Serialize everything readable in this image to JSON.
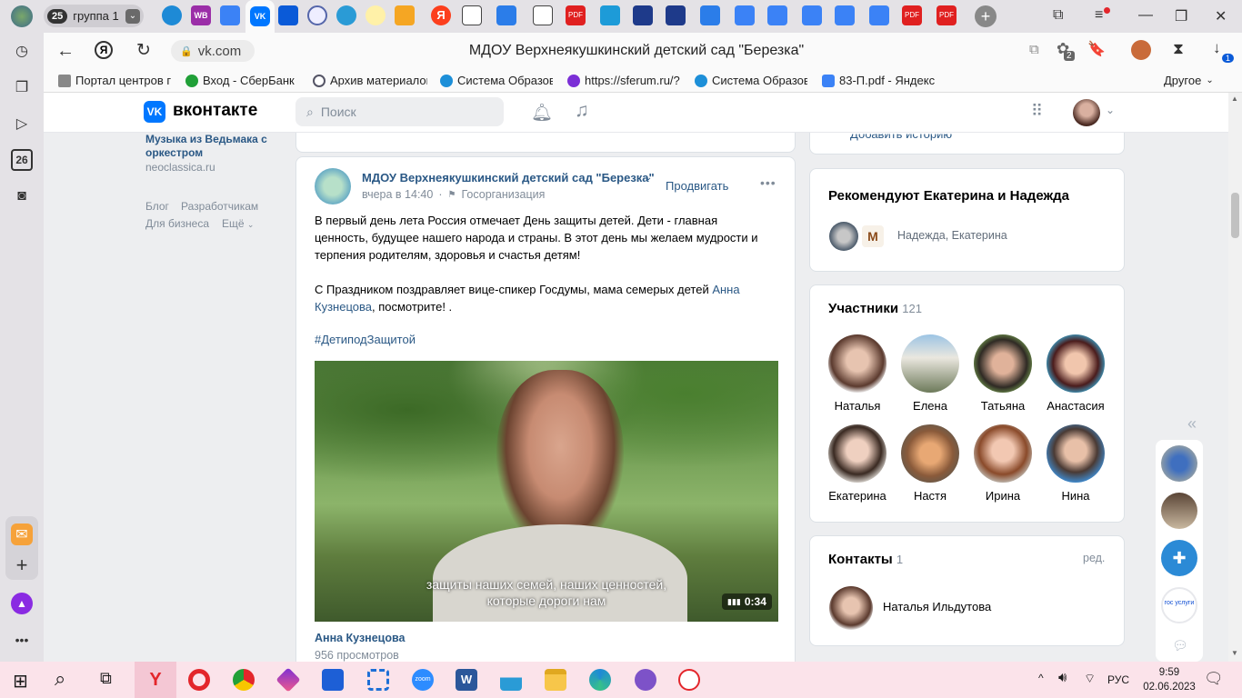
{
  "tabstrip": {
    "group_count": "25",
    "group_name": "группа 1"
  },
  "navbar": {
    "url": "vk.com",
    "page_title": "МДОУ Верхнеякушкинский детский сад \"Березка\"",
    "downloads_badge": "1",
    "extensions_badge": "2"
  },
  "bookmarks": {
    "items": [
      {
        "label": "Портал центров г"
      },
      {
        "label": "Вход - СберБанк С"
      },
      {
        "label": "Архив материалов"
      },
      {
        "label": "Система Образов"
      },
      {
        "label": "https://sferum.ru/?"
      },
      {
        "label": "Система Образов"
      },
      {
        "label": "83-П.pdf - Яндекс"
      }
    ],
    "other": "Другое"
  },
  "left_sidebar": {
    "calendar_day": "26"
  },
  "vk_header": {
    "logo": "VK",
    "name": "вконтакте",
    "search_placeholder": "Поиск"
  },
  "left_column": {
    "playlist_title": "Музыка из Ведьмака с оркестром",
    "playlist_source": "neoclassica.ru",
    "footer_links": [
      "Блог",
      "Разработчикам",
      "Для бизнеса",
      "Ещё"
    ]
  },
  "post": {
    "author": "МДОУ Верхнеякушкинский детский сад \"Березка\"",
    "time": "вчера в 14:40",
    "org_type": "Госорганизация",
    "promote": "Продвигать",
    "text_p1": "В первый день лета Россия отмечает День защиты детей. Дети - главная ценность, будущее нашего народа и страны. В этот день мы желаем мудрости и терпения родителям, здоровья и счастья детям!",
    "text_p2_before": "С Праздником поздравляет вице-спикер Госдумы, мама семерых детей ",
    "text_p2_link": "Анна Кузнецова",
    "text_p2_after": ", посмотрите! .",
    "hashtag": "#ДетиподЗащитой",
    "video_subtitle_line1": "защиты наших семей, наших ценностей,",
    "video_subtitle_line2": "которые дороги нам",
    "video_duration": "0:34",
    "video_author": "Анна Кузнецова",
    "video_views": "956 просмотров"
  },
  "right_column": {
    "stories_label": "Добавить историю",
    "recommend_title": "Рекомендуют Екатерина и Надежда",
    "recommend_names": "Надежда, Екатерина",
    "members_title": "Участники",
    "members_count": "121",
    "members": [
      {
        "name": "Наталья"
      },
      {
        "name": "Елена"
      },
      {
        "name": "Татьяна"
      },
      {
        "name": "Анастасия"
      },
      {
        "name": "Екатерина"
      },
      {
        "name": "Настя"
      },
      {
        "name": "Ирина"
      },
      {
        "name": "Нина"
      }
    ],
    "contacts_title": "Контакты",
    "contacts_count": "1",
    "contacts_edit": "ред.",
    "contact_name": "Наталья Ильдутова"
  },
  "right_sidebar": {
    "gosuslugi_label": "гос услуги"
  },
  "taskbar": {
    "lang": "РУС",
    "time": "9:59",
    "date": "02.06.2023"
  }
}
